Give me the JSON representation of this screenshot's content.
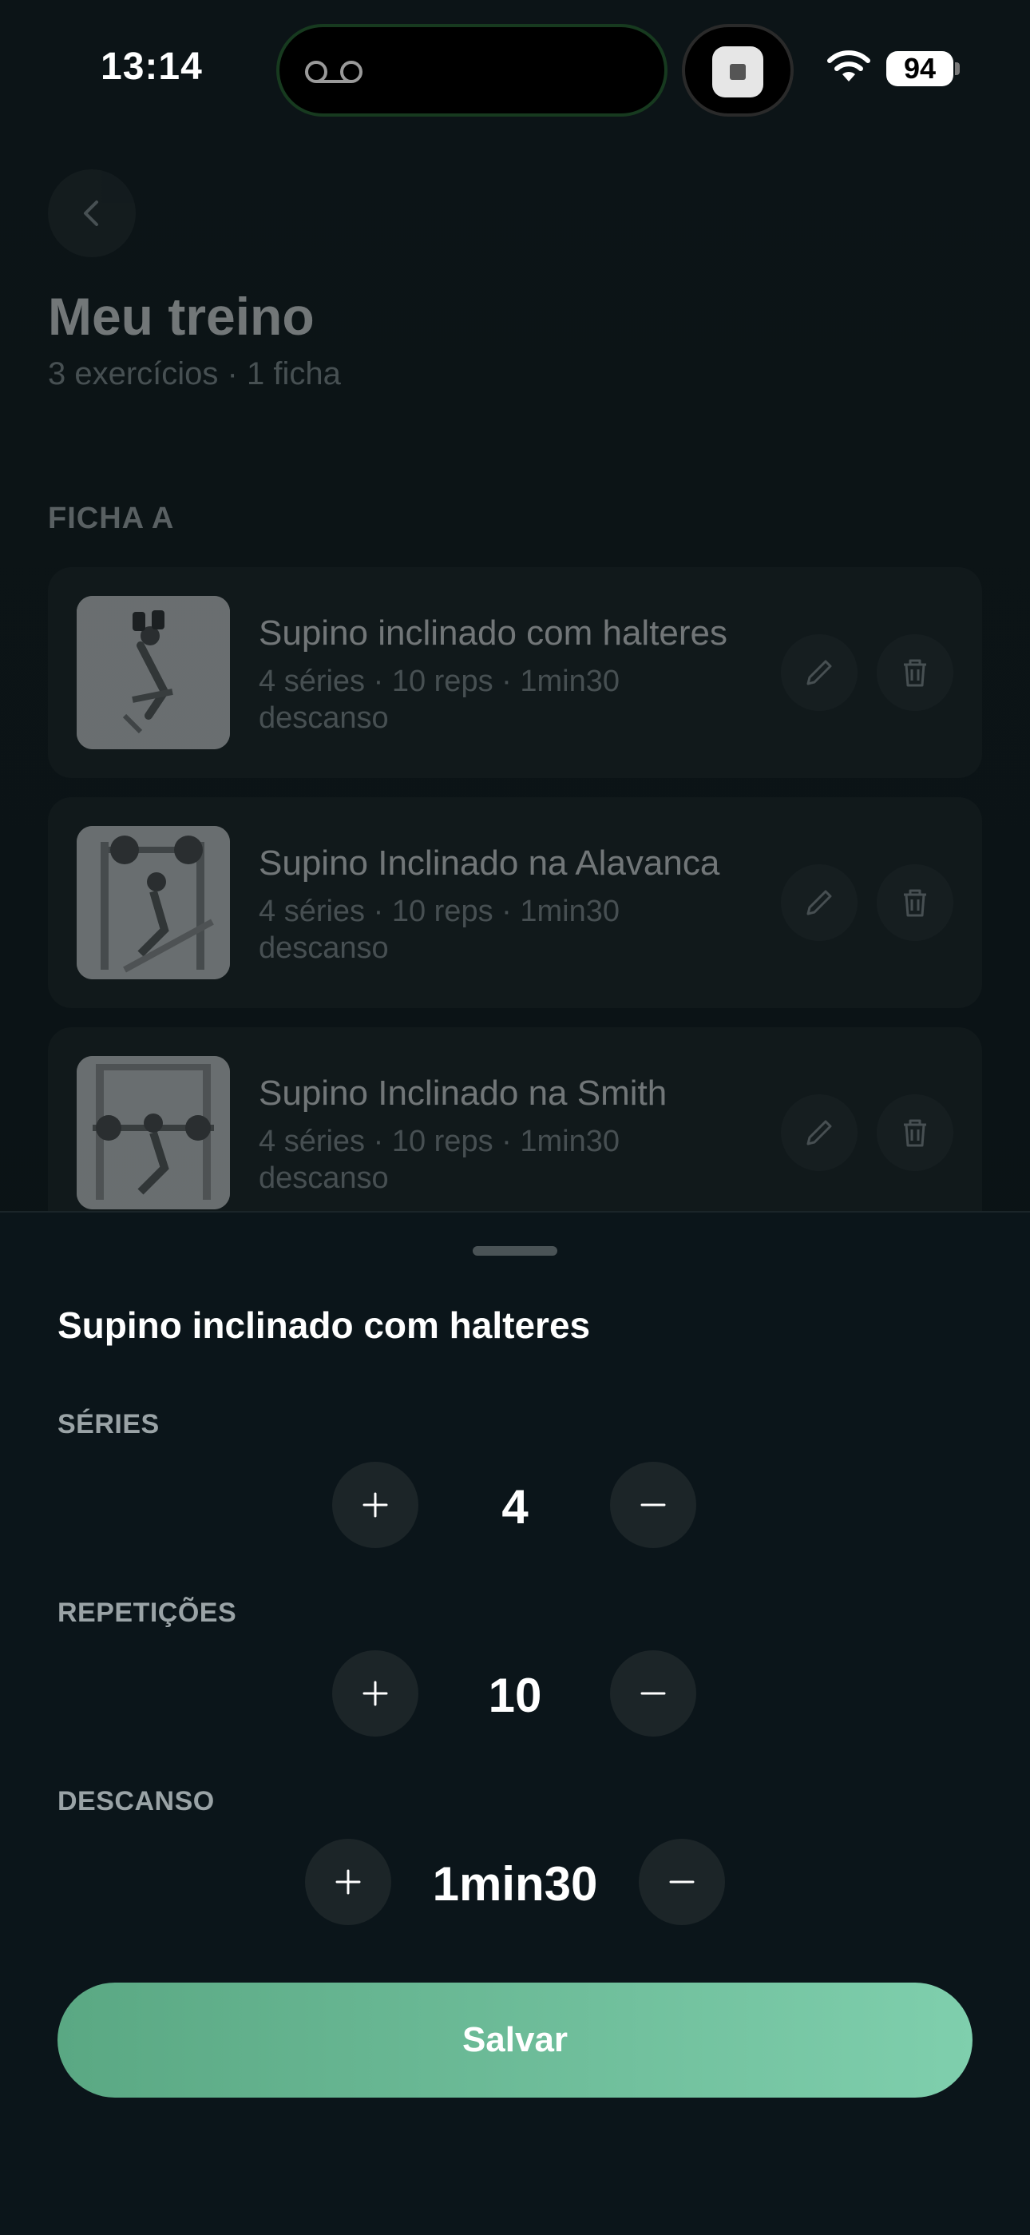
{
  "status_bar": {
    "time": "13:14",
    "battery": "94"
  },
  "page": {
    "title": "Meu treino",
    "subtitle": "3 exercícios · 1 ficha",
    "section_label": "FICHA A"
  },
  "exercises": [
    {
      "name": "Supino inclinado com halteres",
      "meta_line1": "4 séries · 10 reps · 1min30",
      "meta_line2": "descanso"
    },
    {
      "name": "Supino Inclinado na Alavanca",
      "meta_line1": "4 séries · 10 reps · 1min30",
      "meta_line2": "descanso"
    },
    {
      "name": "Supino Inclinado na Smith",
      "meta_line1": "4 séries · 10 reps · 1min30",
      "meta_line2": "descanso"
    }
  ],
  "sheet": {
    "title": "Supino inclinado com halteres",
    "fields": [
      {
        "label": "SÉRIES",
        "value": "4"
      },
      {
        "label": "REPETIÇÕES",
        "value": "10"
      },
      {
        "label": "DESCANSO",
        "value": "1min30"
      }
    ],
    "save_label": "Salvar"
  },
  "colors": {
    "accent_start": "#5aa883",
    "accent_end": "#7fcfad",
    "background": "#0b151a"
  }
}
